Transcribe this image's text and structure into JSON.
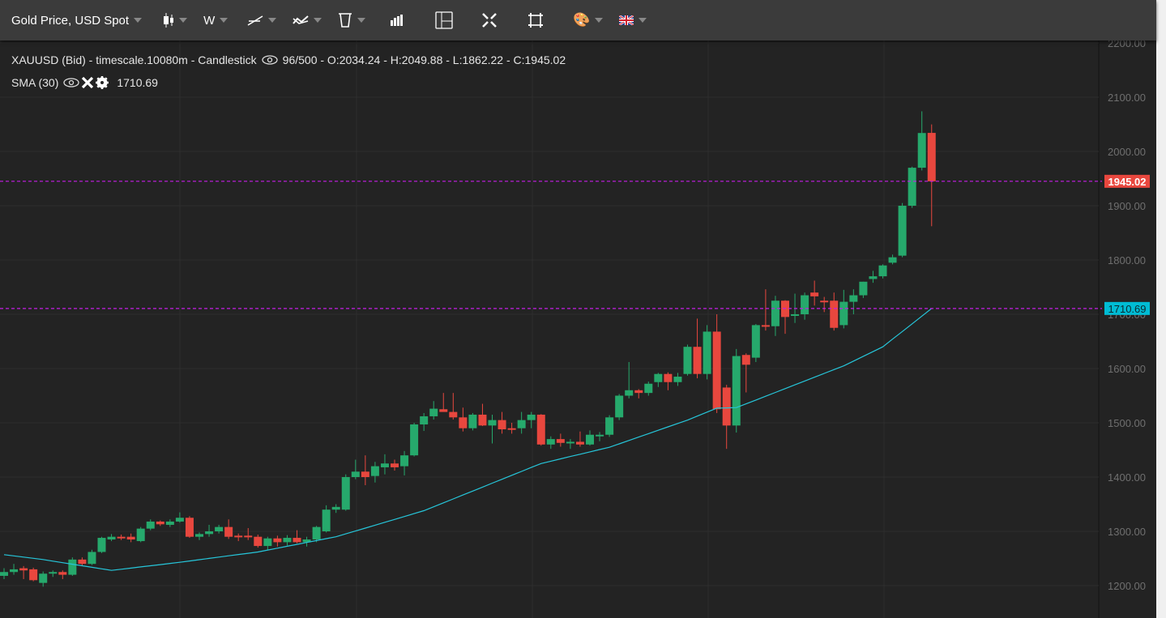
{
  "toolbar": {
    "symbol_label": "Gold Price, USD Spot",
    "interval_label": "W",
    "icons": [
      "candlestick-icon",
      "trendline-icon",
      "indicator-icon",
      "trash-icon",
      "volume-bars-icon",
      "layout-icon",
      "fullscreen-icon",
      "crop-icon",
      "palette-icon",
      "uk-flag-icon"
    ]
  },
  "legend": {
    "series_text": "XAUUSD (Bid) - timescale.10080m - Candlestick",
    "series_stats": "96/500 - O:2034.24 - H:2049.88 - L:1862.22 - C:1945.02",
    "sma_label": "SMA (30)",
    "sma_value": "1710.69"
  },
  "price_tags": {
    "last_price": "1945.02",
    "sma_price": "1710.69"
  },
  "colors": {
    "up": "#26a96c",
    "down": "#e8473e",
    "sma": "#26c6da",
    "price_line": "#c41ee6",
    "sma_tag": "#00bcd4",
    "grid": "#2e2e2e"
  },
  "chart_data": {
    "type": "candlestick",
    "symbol": "XAUUSD",
    "y_ticks": [
      "1200.00",
      "1300.00",
      "1400.00",
      "1500.00",
      "1600.00",
      "1700.00",
      "1800.00",
      "1900.00",
      "2000.00",
      "2100.00",
      "2200.00"
    ],
    "ylim": [
      1200,
      2200
    ],
    "ohlc": [
      [
        1218,
        1232,
        1212,
        1225
      ],
      [
        1225,
        1240,
        1220,
        1230
      ],
      [
        1232,
        1236,
        1212,
        1228
      ],
      [
        1230,
        1233,
        1208,
        1210
      ],
      [
        1205,
        1226,
        1198,
        1222
      ],
      [
        1222,
        1228,
        1216,
        1225
      ],
      [
        1225,
        1228,
        1212,
        1220
      ],
      [
        1220,
        1252,
        1218,
        1248
      ],
      [
        1248,
        1252,
        1236,
        1240
      ],
      [
        1240,
        1266,
        1238,
        1262
      ],
      [
        1262,
        1290,
        1260,
        1288
      ],
      [
        1285,
        1295,
        1282,
        1290
      ],
      [
        1290,
        1294,
        1284,
        1287
      ],
      [
        1290,
        1296,
        1280,
        1285
      ],
      [
        1282,
        1308,
        1280,
        1305
      ],
      [
        1305,
        1322,
        1302,
        1318
      ],
      [
        1318,
        1320,
        1310,
        1313
      ],
      [
        1312,
        1322,
        1308,
        1318
      ],
      [
        1318,
        1335,
        1316,
        1325
      ],
      [
        1325,
        1328,
        1288,
        1290
      ],
      [
        1290,
        1298,
        1284,
        1295
      ],
      [
        1295,
        1312,
        1290,
        1300
      ],
      [
        1300,
        1312,
        1296,
        1308
      ],
      [
        1308,
        1322,
        1286,
        1290
      ],
      [
        1292,
        1296,
        1282,
        1290
      ],
      [
        1292,
        1306,
        1284,
        1290
      ],
      [
        1290,
        1294,
        1270,
        1273
      ],
      [
        1273,
        1290,
        1266,
        1287
      ],
      [
        1287,
        1292,
        1272,
        1280
      ],
      [
        1280,
        1293,
        1274,
        1288
      ],
      [
        1288,
        1302,
        1278,
        1280
      ],
      [
        1280,
        1290,
        1272,
        1285
      ],
      [
        1285,
        1310,
        1280,
        1308
      ],
      [
        1300,
        1348,
        1298,
        1340
      ],
      [
        1340,
        1350,
        1334,
        1345
      ],
      [
        1340,
        1405,
        1338,
        1400
      ],
      [
        1400,
        1432,
        1396,
        1410
      ],
      [
        1410,
        1440,
        1385,
        1400
      ],
      [
        1402,
        1428,
        1390,
        1420
      ],
      [
        1418,
        1442,
        1405,
        1425
      ],
      [
        1425,
        1432,
        1412,
        1418
      ],
      [
        1420,
        1448,
        1403,
        1440
      ],
      [
        1440,
        1500,
        1438,
        1497
      ],
      [
        1497,
        1518,
        1485,
        1512
      ],
      [
        1512,
        1540,
        1506,
        1526
      ],
      [
        1525,
        1555,
        1522,
        1520
      ],
      [
        1520,
        1555,
        1506,
        1510
      ],
      [
        1510,
        1528,
        1484,
        1490
      ],
      [
        1490,
        1518,
        1486,
        1515
      ],
      [
        1515,
        1535,
        1494,
        1495
      ],
      [
        1495,
        1515,
        1462,
        1505
      ],
      [
        1505,
        1520,
        1480,
        1488
      ],
      [
        1490,
        1500,
        1480,
        1488
      ],
      [
        1490,
        1520,
        1480,
        1505
      ],
      [
        1505,
        1520,
        1490,
        1515
      ],
      [
        1515,
        1516,
        1458,
        1460
      ],
      [
        1460,
        1475,
        1452,
        1470
      ],
      [
        1470,
        1480,
        1456,
        1463
      ],
      [
        1462,
        1470,
        1452,
        1465
      ],
      [
        1465,
        1484,
        1456,
        1460
      ],
      [
        1460,
        1486,
        1458,
        1478
      ],
      [
        1475,
        1483,
        1466,
        1478
      ],
      [
        1478,
        1514,
        1474,
        1510
      ],
      [
        1510,
        1553,
        1505,
        1550
      ],
      [
        1550,
        1612,
        1545,
        1560
      ],
      [
        1560,
        1562,
        1545,
        1555
      ],
      [
        1555,
        1576,
        1550,
        1572
      ],
      [
        1575,
        1592,
        1566,
        1590
      ],
      [
        1590,
        1593,
        1560,
        1575
      ],
      [
        1575,
        1592,
        1568,
        1585
      ],
      [
        1590,
        1644,
        1587,
        1640
      ],
      [
        1640,
        1692,
        1582,
        1590
      ],
      [
        1590,
        1680,
        1580,
        1668
      ],
      [
        1668,
        1700,
        1518,
        1525
      ],
      [
        1565,
        1570,
        1452,
        1495
      ],
      [
        1495,
        1636,
        1482,
        1623
      ],
      [
        1625,
        1628,
        1556,
        1607
      ],
      [
        1620,
        1682,
        1612,
        1680
      ],
      [
        1680,
        1746,
        1670,
        1677
      ],
      [
        1678,
        1734,
        1660,
        1725
      ],
      [
        1725,
        1726,
        1664,
        1695
      ],
      [
        1698,
        1738,
        1684,
        1700
      ],
      [
        1700,
        1740,
        1690,
        1735
      ],
      [
        1740,
        1762,
        1716,
        1733
      ],
      [
        1725,
        1732,
        1704,
        1722
      ],
      [
        1725,
        1740,
        1670,
        1675
      ],
      [
        1680,
        1745,
        1674,
        1723
      ],
      [
        1723,
        1746,
        1700,
        1735
      ],
      [
        1735,
        1760,
        1730,
        1760
      ],
      [
        1765,
        1780,
        1758,
        1770
      ],
      [
        1770,
        1792,
        1766,
        1790
      ],
      [
        1795,
        1810,
        1792,
        1805
      ],
      [
        1808,
        1905,
        1805,
        1900
      ],
      [
        1900,
        1972,
        1896,
        1970
      ],
      [
        1970,
        2074,
        1965,
        2034
      ],
      [
        2034.24,
        2049.88,
        1862.22,
        1945.02
      ]
    ],
    "sma_points": [
      [
        0,
        1257
      ],
      [
        4,
        1248
      ],
      [
        11,
        1228
      ],
      [
        18,
        1243
      ],
      [
        26,
        1262
      ],
      [
        34,
        1290
      ],
      [
        43,
        1338
      ],
      [
        55,
        1425
      ],
      [
        62,
        1455
      ],
      [
        70,
        1505
      ],
      [
        73,
        1527
      ],
      [
        75,
        1528
      ],
      [
        86,
        1605
      ],
      [
        90,
        1640
      ],
      [
        95,
        1710.69
      ]
    ]
  }
}
